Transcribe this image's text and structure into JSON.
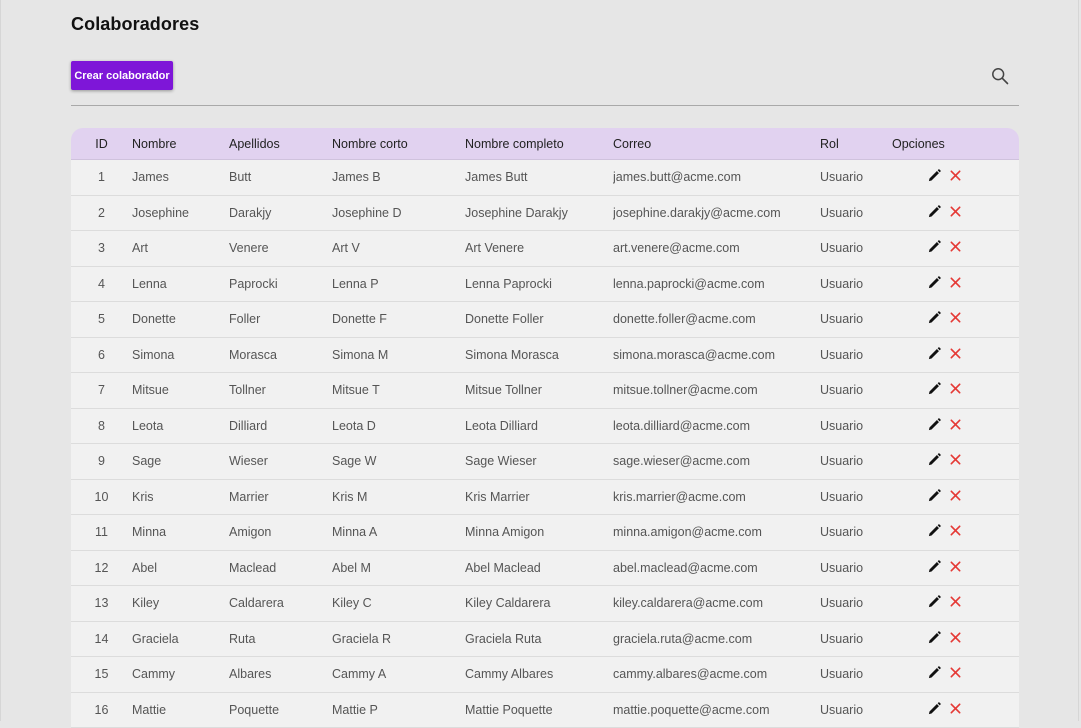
{
  "page": {
    "title": "Colaboradores",
    "create_button_label": "Crear colaborador",
    "search_icon": "search-icon"
  },
  "colors": {
    "accent": "#7e16d8",
    "header_bg": "#e1d2f0",
    "delete": "#e53935"
  },
  "table": {
    "columns": [
      "ID",
      "Nombre",
      "Apellidos",
      "Nombre corto",
      "Nombre completo",
      "Correo",
      "Rol",
      "Opciones"
    ],
    "rows": [
      [
        "1",
        "James",
        "Butt",
        "James B",
        "James Butt",
        "james.butt@acme.com",
        "Usuario"
      ],
      [
        "2",
        "Josephine",
        "Darakjy",
        "Josephine D",
        "Josephine Darakjy",
        "josephine.darakjy@acme.com",
        "Usuario"
      ],
      [
        "3",
        "Art",
        "Venere",
        "Art V",
        "Art Venere",
        "art.venere@acme.com",
        "Usuario"
      ],
      [
        "4",
        "Lenna",
        "Paprocki",
        "Lenna P",
        "Lenna Paprocki",
        "lenna.paprocki@acme.com",
        "Usuario"
      ],
      [
        "5",
        "Donette",
        "Foller",
        "Donette F",
        "Donette Foller",
        "donette.foller@acme.com",
        "Usuario"
      ],
      [
        "6",
        "Simona",
        "Morasca",
        "Simona M",
        "Simona Morasca",
        "simona.morasca@acme.com",
        "Usuario"
      ],
      [
        "7",
        "Mitsue",
        "Tollner",
        "Mitsue T",
        "Mitsue Tollner",
        "mitsue.tollner@acme.com",
        "Usuario"
      ],
      [
        "8",
        "Leota",
        "Dilliard",
        "Leota D",
        "Leota Dilliard",
        "leota.dilliard@acme.com",
        "Usuario"
      ],
      [
        "9",
        "Sage",
        "Wieser",
        "Sage W",
        "Sage Wieser",
        "sage.wieser@acme.com",
        "Usuario"
      ],
      [
        "10",
        "Kris",
        "Marrier",
        "Kris M",
        "Kris Marrier",
        "kris.marrier@acme.com",
        "Usuario"
      ],
      [
        "11",
        "Minna",
        "Amigon",
        "Minna A",
        "Minna Amigon",
        "minna.amigon@acme.com",
        "Usuario"
      ],
      [
        "12",
        "Abel",
        "Maclead",
        "Abel M",
        "Abel Maclead",
        "abel.maclead@acme.com",
        "Usuario"
      ],
      [
        "13",
        "Kiley",
        "Caldarera",
        "Kiley C",
        "Kiley Caldarera",
        "kiley.caldarera@acme.com",
        "Usuario"
      ],
      [
        "14",
        "Graciela",
        "Ruta",
        "Graciela R",
        "Graciela Ruta",
        "graciela.ruta@acme.com",
        "Usuario"
      ],
      [
        "15",
        "Cammy",
        "Albares",
        "Cammy A",
        "Cammy Albares",
        "cammy.albares@acme.com",
        "Usuario"
      ],
      [
        "16",
        "Mattie",
        "Poquette",
        "Mattie P",
        "Mattie Poquette",
        "mattie.poquette@acme.com",
        "Usuario"
      ]
    ],
    "row_actions": [
      "edit-icon",
      "delete-icon"
    ]
  }
}
